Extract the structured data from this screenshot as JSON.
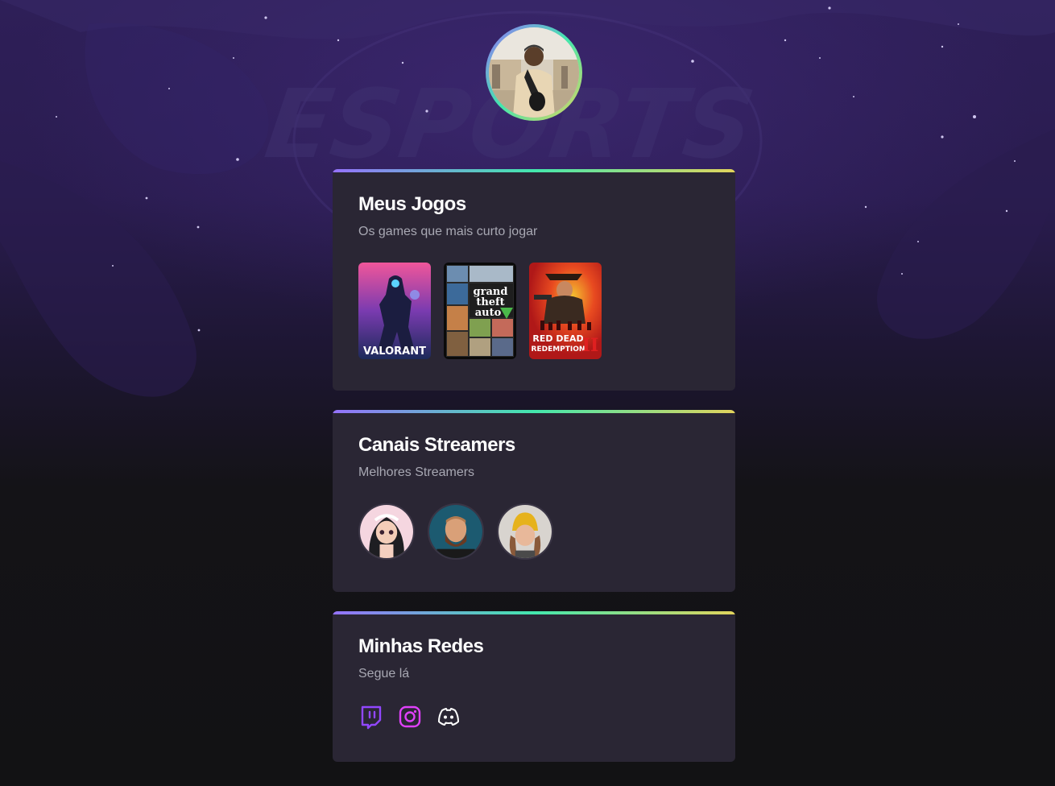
{
  "profile": {
    "avatar_alt": "Foto de perfil"
  },
  "background": {
    "watermark": "ESPORTS"
  },
  "cards": {
    "games": {
      "title": "Meus Jogos",
      "subtitle": "Os games que mais curto jogar",
      "items": [
        {
          "name": "Valorant",
          "cover_text": "VALORANT"
        },
        {
          "name": "Grand Theft Auto V",
          "cover_text_1": "grand",
          "cover_text_2": "theft",
          "cover_text_3": "auto"
        },
        {
          "name": "Red Dead Redemption II",
          "cover_text_1": "RED DEAD",
          "cover_text_2": "REDEMPTION",
          "cover_text_3": "II"
        }
      ]
    },
    "streamers": {
      "title": "Canais Streamers",
      "subtitle": "Melhores Streamers"
    },
    "socials": {
      "title": "Minhas Redes",
      "subtitle": "Segue lá",
      "items": [
        "twitch-icon",
        "instagram-icon",
        "discord-icon"
      ]
    }
  },
  "colors": {
    "accent_gradient": [
      "#9572fc",
      "#43e7ad",
      "#e2d45c"
    ],
    "card_bg": "#2a2634",
    "twitch": "#9147ff",
    "instagram": "#e040fb",
    "discord": "#ffffff"
  }
}
